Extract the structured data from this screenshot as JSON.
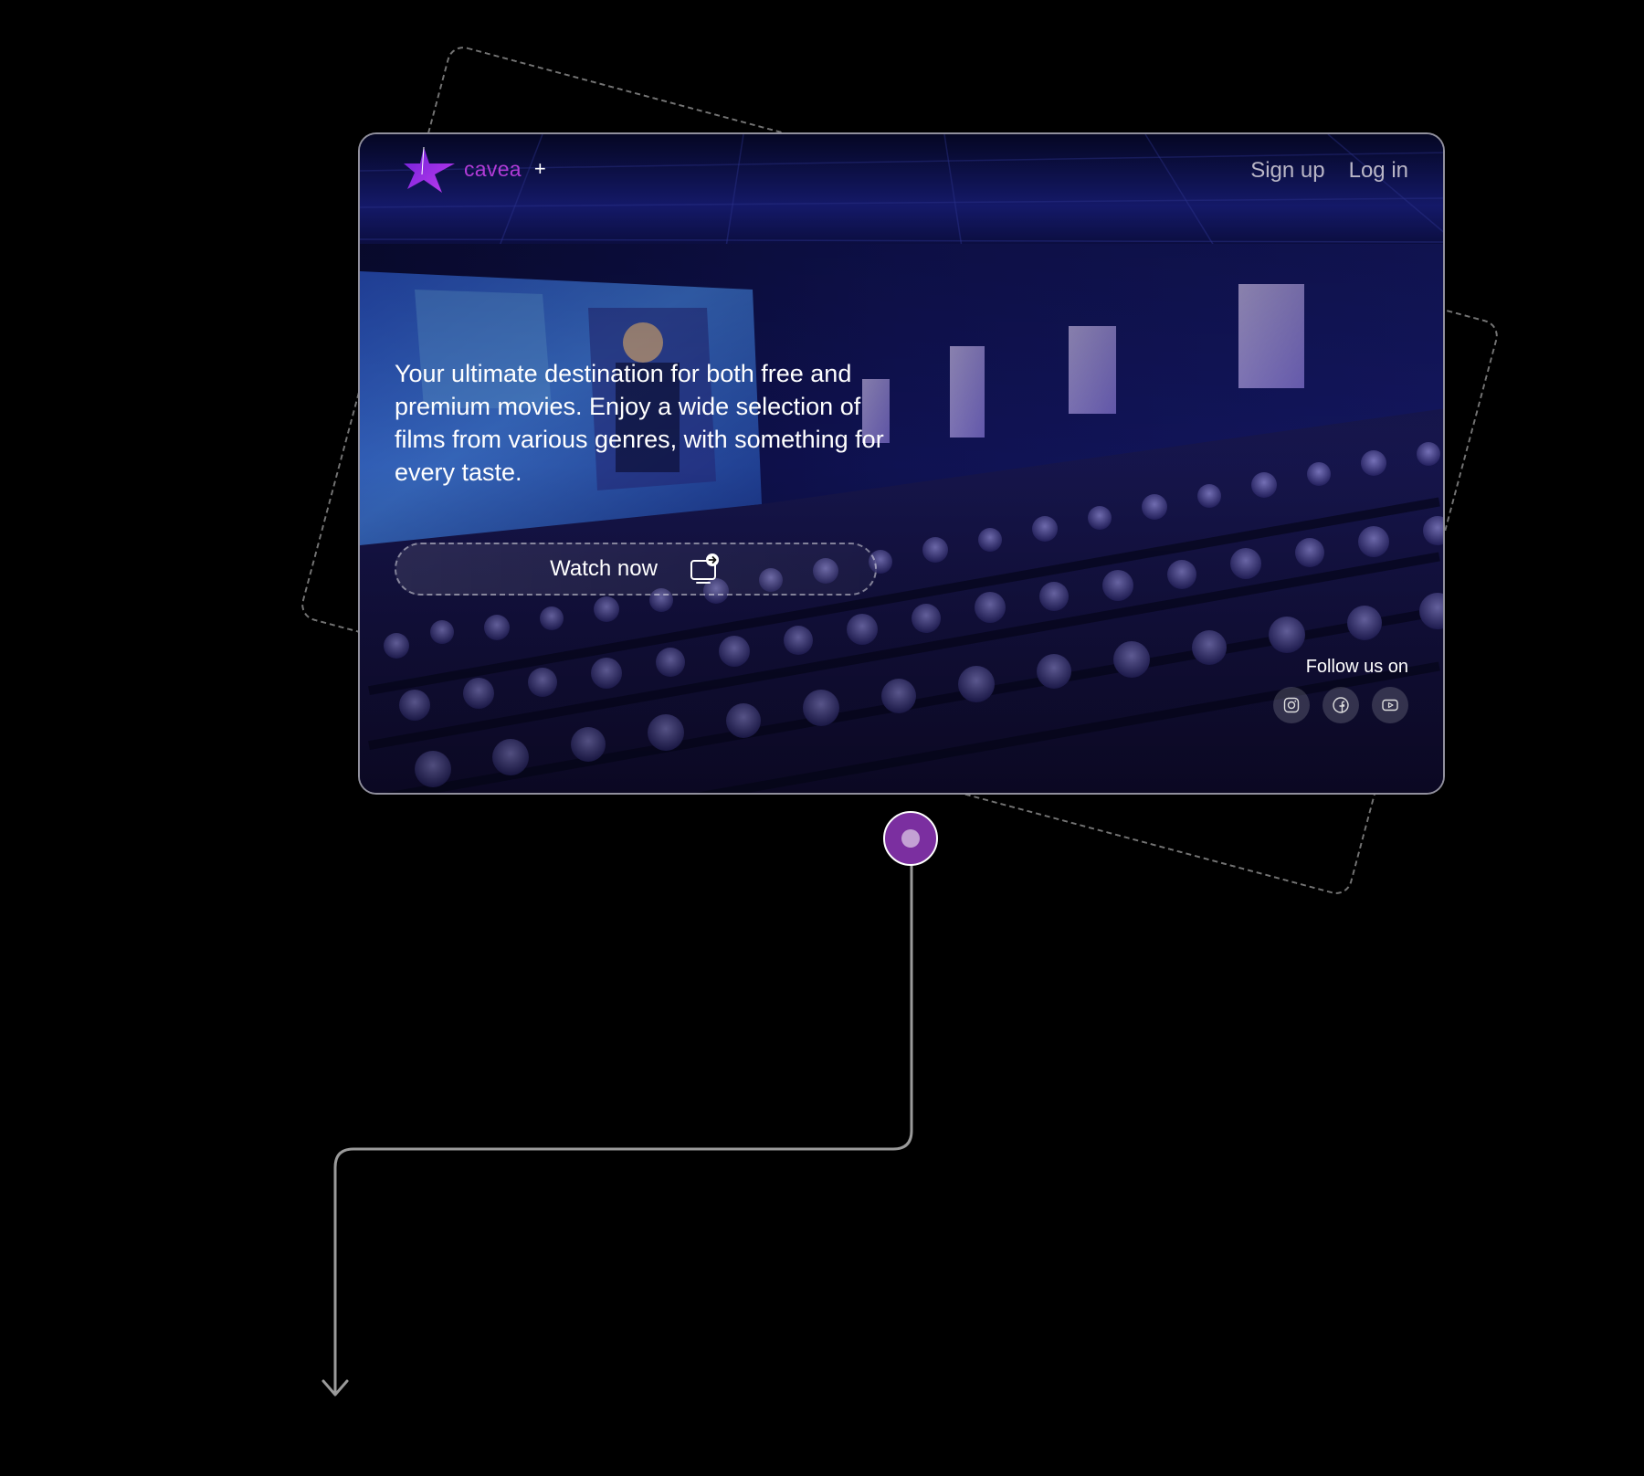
{
  "brand": {
    "name": "cavea",
    "plus": "+",
    "logo_icon": "star-logo-icon",
    "accent_color": "#b13bd6"
  },
  "nav": {
    "signup_label": "Sign up",
    "login_label": "Log in"
  },
  "hero": {
    "tagline": "Your ultimate destination for both free and premium movies. Enjoy a wide selection of films from various genres, with something for every taste.",
    "background": "cinema-audience-photo",
    "watch_button": {
      "label": "Watch now",
      "icon": "screen-arrow-icon"
    }
  },
  "social": {
    "label": "Follow us on",
    "links": [
      {
        "name": "instagram",
        "icon": "instagram-icon"
      },
      {
        "name": "facebook",
        "icon": "facebook-icon"
      },
      {
        "name": "youtube",
        "icon": "youtube-icon"
      }
    ]
  },
  "connector": {
    "node_color": "#7b2fa0",
    "line_color": "#9a9a9a",
    "arrow_icon": "arrow-down-icon"
  }
}
